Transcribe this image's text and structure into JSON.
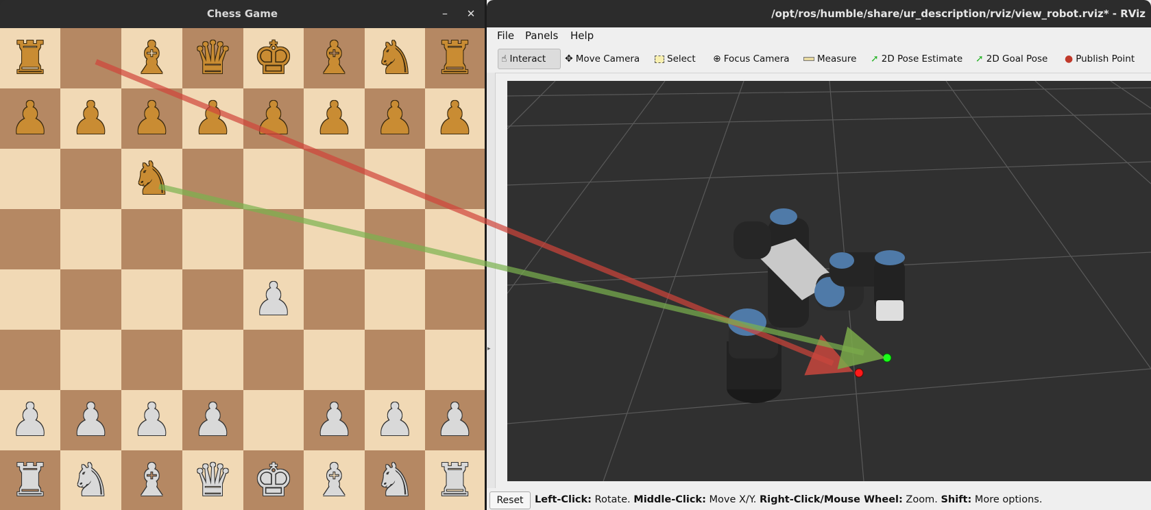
{
  "chess": {
    "title": "Chess Game",
    "minimize_glyph": "–",
    "close_glyph": "✕",
    "colors": {
      "light_square": "#f1d9b5",
      "dark_square": "#b58863",
      "black_piece": "#c98c33",
      "white_piece": "#d9d9d9"
    },
    "board": [
      [
        "bR",
        "",
        "bB",
        "bQ",
        "bK",
        "bB",
        "bN",
        "bR"
      ],
      [
        "bP",
        "bP",
        "bP",
        "bP",
        "bP",
        "bP",
        "bP",
        "bP"
      ],
      [
        "",
        "",
        "bN",
        "",
        "",
        "",
        "",
        ""
      ],
      [
        "",
        "",
        "",
        "",
        "",
        "",
        "",
        ""
      ],
      [
        "",
        "",
        "",
        "",
        "wP",
        "",
        "",
        ""
      ],
      [
        "",
        "",
        "",
        "",
        "",
        "",
        "",
        ""
      ],
      [
        "wP",
        "wP",
        "wP",
        "wP",
        "",
        "wP",
        "wP",
        "wP"
      ],
      [
        "wR",
        "wN",
        "wB",
        "wQ",
        "wK",
        "wB",
        "wN",
        "wR"
      ]
    ],
    "piece_glyphs": {
      "R": "♜",
      "N": "♞",
      "B": "♝",
      "Q": "♛",
      "K": "♚",
      "P": "♟"
    }
  },
  "rviz": {
    "title": "/opt/ros/humble/share/ur_description/rviz/view_robot.rviz* - RViz",
    "menu": [
      {
        "label": "File"
      },
      {
        "label": "Panels"
      },
      {
        "label": "Help"
      }
    ],
    "toolbar": [
      {
        "label": "Interact",
        "icon": "hand-icon",
        "active": true
      },
      {
        "label": "Move Camera",
        "icon": "move-camera-icon"
      },
      {
        "label": "Select",
        "icon": "select-icon"
      },
      {
        "label": "Focus Camera",
        "icon": "focus-camera-icon"
      },
      {
        "label": "Measure",
        "icon": "ruler-icon"
      },
      {
        "label": "2D Pose Estimate",
        "icon": "pose-estimate-icon"
      },
      {
        "label": "2D Goal Pose",
        "icon": "goal-pose-icon"
      },
      {
        "label": "Publish Point",
        "icon": "map-pin-icon"
      }
    ],
    "status": {
      "reset_label": "Reset",
      "hint": [
        {
          "bold": "Left-Click:",
          "text": " Rotate. "
        },
        {
          "bold": "Middle-Click:",
          "text": " Move X/Y. "
        },
        {
          "bold": "Right-Click/Mouse Wheel:",
          "text": " Zoom. "
        },
        {
          "bold": "Shift:",
          "text": " More options."
        }
      ]
    },
    "colors": {
      "viewport_bg": "#303030",
      "grid": "#555555",
      "red_marker": "#ff1a1a",
      "green_marker": "#1aff1a",
      "arrow_red": "#d0413a",
      "arrow_green": "#7bb24e"
    }
  }
}
